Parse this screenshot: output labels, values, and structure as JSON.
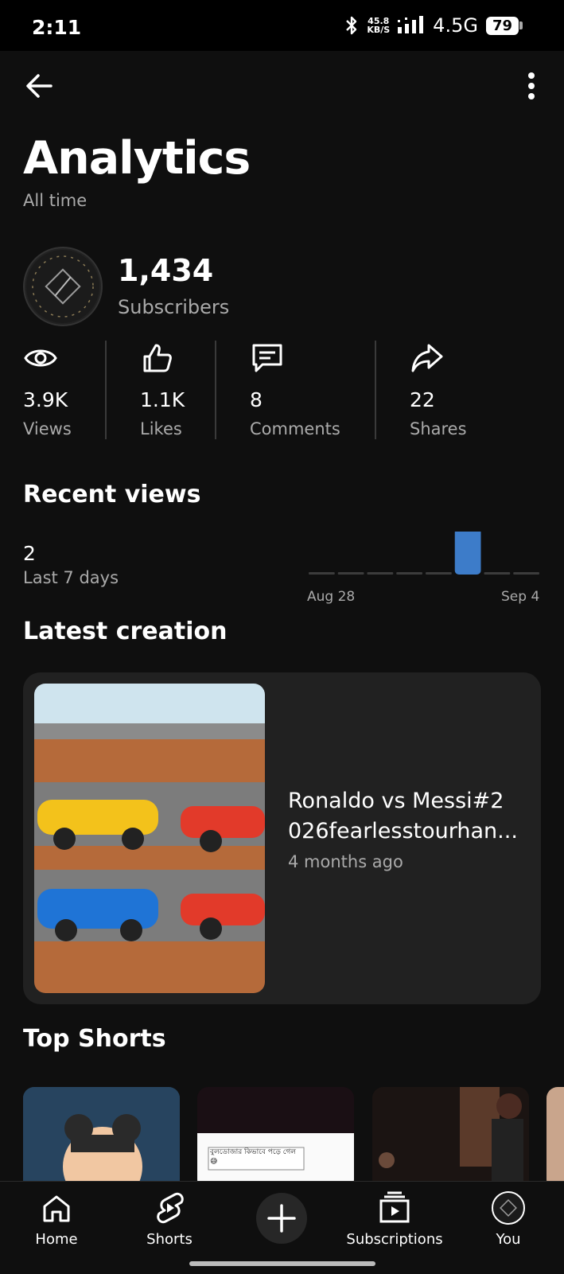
{
  "status_bar": {
    "time": "2:11",
    "speed_top": "45.8",
    "speed_bottom": "KB/S",
    "network": "4.5G",
    "battery": "79"
  },
  "header": {
    "title": "Analytics",
    "subtitle": "All time"
  },
  "channel": {
    "subscriber_count": "1,434",
    "subscriber_label": "Subscribers"
  },
  "metrics": [
    {
      "value": "3.9K",
      "label": "Views",
      "icon": "eye-icon"
    },
    {
      "value": "1.1K",
      "label": "Likes",
      "icon": "thumbs-up-icon"
    },
    {
      "value": "8",
      "label": "Comments",
      "icon": "comment-icon"
    },
    {
      "value": "22",
      "label": "Shares",
      "icon": "share-icon"
    }
  ],
  "recent_views": {
    "title": "Recent views",
    "value": "2",
    "label": "Last 7 days",
    "chart_data": {
      "type": "bar",
      "x_tick_labels": [
        "Aug 28",
        "Sep 4"
      ],
      "values": [
        0,
        0,
        0,
        0,
        0,
        2,
        0,
        0
      ],
      "accent_color": "#3d7cc9"
    }
  },
  "latest_creation": {
    "title": "Latest creation",
    "video_title_line1": "Ronaldo vs Messi#2",
    "video_title_line2": "026fearlesstourhan...",
    "time": "4 months ago",
    "thumb_text": ""
  },
  "top_shorts": {
    "title": "Top Shorts",
    "short2_caption": "বুলডোজার কিভাবে পড়ে গেল 😅"
  },
  "nav": {
    "home": "Home",
    "shorts": "Shorts",
    "subscriptions": "Subscriptions",
    "you": "You"
  }
}
